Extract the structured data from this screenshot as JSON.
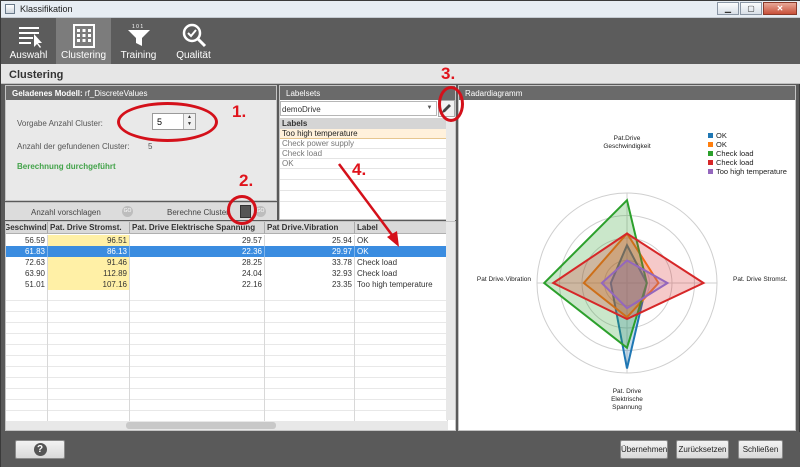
{
  "window": {
    "title": "Klassifikation",
    "min_icon": "minimize-icon",
    "max_icon": "maximize-icon",
    "close_icon": "close-icon"
  },
  "toolbar": [
    {
      "label": "Auswahl",
      "icon": "list-cursor-icon",
      "active": false
    },
    {
      "label": "Clustering",
      "icon": "grid-icon",
      "active": true
    },
    {
      "label": "Training",
      "icon": "funnel-icon",
      "active": false
    },
    {
      "label": "Qualität",
      "icon": "magnifier-check-icon",
      "active": false
    }
  ],
  "page_title": "Clustering",
  "model": {
    "header_bold": "Geladenes Modell:",
    "header_value": "rf_DiscreteValues",
    "cluster_label": "Vorgabe Anzahl Cluster:",
    "cluster_value": "5",
    "found_label": "Anzahl der gefundenen Cluster:",
    "found_value": "5",
    "status": "Berechnung durchgeführt"
  },
  "actions": {
    "suggest": "Anzahl vorschlagen",
    "compute": "Berechne Cluster"
  },
  "labelsets": {
    "header": "Labelsets",
    "selected": "demoDrive",
    "labels_header": "Labels",
    "labels": [
      "Too high temperature",
      "Check power supply",
      "Check load",
      "OK"
    ]
  },
  "table": {
    "columns": [
      "Geschwindigkeit",
      "Pat. Drive Stromst.",
      "Pat. Drive Elektrische Spannung",
      "Pat Drive.Vibration",
      "Label"
    ],
    "rows": [
      [
        "56.59",
        "96.51",
        "29.57",
        "25.94",
        "OK"
      ],
      [
        "61.83",
        "86.13",
        "22.36",
        "29.97",
        "OK"
      ],
      [
        "72.63",
        "91.46",
        "28.25",
        "33.78",
        "Check load"
      ],
      [
        "63.90",
        "112.89",
        "24.04",
        "32.93",
        "Check load"
      ],
      [
        "51.01",
        "107.16",
        "22.16",
        "23.35",
        "Too high temperature"
      ]
    ],
    "selected_row": 1
  },
  "radar": {
    "header": "Radardiagramm",
    "axes": [
      "Pat.Drive Geschwindigkeit",
      "Pat. Drive Stromst.",
      "Pat. Drive Elektrische Spannung",
      "Pat Drive.Vibration"
    ],
    "legend": [
      {
        "name": "OK",
        "color": "#1f77b4"
      },
      {
        "name": "OK",
        "color": "#ff7f0e"
      },
      {
        "name": "Check load",
        "color": "#2ca02c"
      },
      {
        "name": "Check load",
        "color": "#d62728"
      },
      {
        "name": "Too high temperature",
        "color": "#9467bd"
      }
    ]
  },
  "buttons": {
    "help": "?",
    "accept": "Übernehmen",
    "reset": "Zurücksetzen",
    "close": "Schließen"
  },
  "annotations": [
    "1.",
    "2.",
    "3.",
    "4."
  ]
}
